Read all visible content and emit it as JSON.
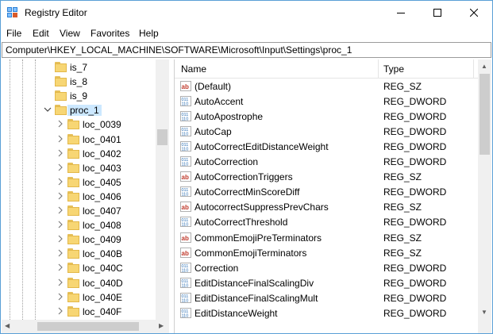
{
  "window": {
    "title": "Registry Editor",
    "icon": "registry-editor-icon"
  },
  "menu": [
    "File",
    "Edit",
    "View",
    "Favorites",
    "Help"
  ],
  "address": "Computer\\HKEY_LOCAL_MACHINE\\SOFTWARE\\Microsoft\\Input\\Settings\\proc_1",
  "tree": {
    "items": [
      {
        "label": "is_7",
        "level": 1,
        "expandable": false
      },
      {
        "label": "is_8",
        "level": 1,
        "expandable": false
      },
      {
        "label": "is_9",
        "level": 1,
        "expandable": false
      },
      {
        "label": "proc_1",
        "level": 1,
        "expandable": true,
        "expanded": true,
        "selected": true
      },
      {
        "label": "loc_0039",
        "level": 2,
        "expandable": true
      },
      {
        "label": "loc_0401",
        "level": 2,
        "expandable": true
      },
      {
        "label": "loc_0402",
        "level": 2,
        "expandable": true
      },
      {
        "label": "loc_0403",
        "level": 2,
        "expandable": true
      },
      {
        "label": "loc_0405",
        "level": 2,
        "expandable": true
      },
      {
        "label": "loc_0406",
        "level": 2,
        "expandable": true
      },
      {
        "label": "loc_0407",
        "level": 2,
        "expandable": true
      },
      {
        "label": "loc_0408",
        "level": 2,
        "expandable": true
      },
      {
        "label": "loc_0409",
        "level": 2,
        "expandable": true
      },
      {
        "label": "loc_040B",
        "level": 2,
        "expandable": true
      },
      {
        "label": "loc_040C",
        "level": 2,
        "expandable": true
      },
      {
        "label": "loc_040D",
        "level": 2,
        "expandable": true
      },
      {
        "label": "loc_040E",
        "level": 2,
        "expandable": true
      },
      {
        "label": "loc_040F",
        "level": 2,
        "expandable": true
      }
    ]
  },
  "list": {
    "columns": {
      "name": "Name",
      "type": "Type"
    },
    "rows": [
      {
        "name": "(Default)",
        "type": "REG_SZ",
        "icon": "string-value-icon"
      },
      {
        "name": "AutoAccent",
        "type": "REG_DWORD",
        "icon": "binary-value-icon"
      },
      {
        "name": "AutoApostrophe",
        "type": "REG_DWORD",
        "icon": "binary-value-icon"
      },
      {
        "name": "AutoCap",
        "type": "REG_DWORD",
        "icon": "binary-value-icon"
      },
      {
        "name": "AutoCorrectEditDistanceWeight",
        "type": "REG_DWORD",
        "icon": "binary-value-icon"
      },
      {
        "name": "AutoCorrection",
        "type": "REG_DWORD",
        "icon": "binary-value-icon"
      },
      {
        "name": "AutoCorrectionTriggers",
        "type": "REG_SZ",
        "icon": "string-value-icon"
      },
      {
        "name": "AutoCorrectMinScoreDiff",
        "type": "REG_DWORD",
        "icon": "binary-value-icon"
      },
      {
        "name": "AutocorrectSuppressPrevChars",
        "type": "REG_SZ",
        "icon": "string-value-icon"
      },
      {
        "name": "AutoCorrectThreshold",
        "type": "REG_DWORD",
        "icon": "binary-value-icon"
      },
      {
        "name": "CommonEmojiPreTerminators",
        "type": "REG_SZ",
        "icon": "string-value-icon"
      },
      {
        "name": "CommonEmojiTerminators",
        "type": "REG_SZ",
        "icon": "string-value-icon"
      },
      {
        "name": "Correction",
        "type": "REG_DWORD",
        "icon": "binary-value-icon"
      },
      {
        "name": "EditDistanceFinalScalingDiv",
        "type": "REG_DWORD",
        "icon": "binary-value-icon"
      },
      {
        "name": "EditDistanceFinalScalingMult",
        "type": "REG_DWORD",
        "icon": "binary-value-icon"
      },
      {
        "name": "EditDistanceWeight",
        "type": "REG_DWORD",
        "icon": "binary-value-icon"
      }
    ]
  },
  "colors": {
    "selection": "#cce8ff",
    "folder": "#f7d674",
    "string_icon": "#c0392b",
    "binary_icon": "#2a6fb5"
  }
}
